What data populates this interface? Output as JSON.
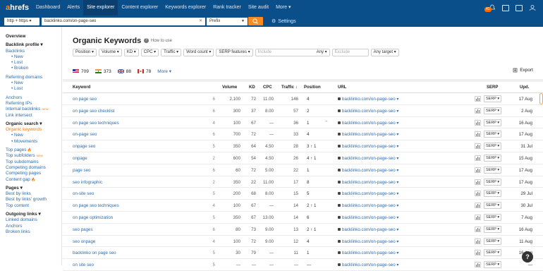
{
  "app": {
    "logo_a": "a",
    "logo_rest": "hrefs"
  },
  "nav": [
    "Dashboard",
    "Alerts",
    "Site explorer",
    "Content explorer",
    "Keywords explorer",
    "Rank tracker",
    "Site audit",
    "More ▾"
  ],
  "nav_active": "Site explorer",
  "top": {
    "notif_count": "41"
  },
  "search": {
    "protocol": "http + https ▾",
    "url": "backlinko.com/on-page-seo",
    "mode": "Prefix",
    "settings": "Settings"
  },
  "sidebar": [
    {
      "t": "Overview",
      "type": "h"
    },
    {
      "t": "Backlink profile ▾",
      "type": "h"
    },
    {
      "t": "Backlinks",
      "type": "link"
    },
    {
      "t": "• New",
      "type": "sub"
    },
    {
      "t": "• Lost",
      "type": "sub"
    },
    {
      "t": "• Broken",
      "type": "sub"
    },
    {
      "t": "Referring domains",
      "type": "link",
      "gap": true
    },
    {
      "t": "• New",
      "type": "sub"
    },
    {
      "t": "• Lost",
      "type": "sub"
    },
    {
      "t": "Anchors",
      "type": "link",
      "gap": true
    },
    {
      "t": "Referring IPs",
      "type": "link"
    },
    {
      "t": "Internal backlinks",
      "type": "link",
      "new": "NEW"
    },
    {
      "t": "Link intersect",
      "type": "link"
    },
    {
      "t": "Organic search ▾",
      "type": "h"
    },
    {
      "t": "Organic keywords",
      "type": "active"
    },
    {
      "t": "• New",
      "type": "sub"
    },
    {
      "t": "• Movements",
      "type": "sub"
    },
    {
      "t": "Top pages",
      "type": "link",
      "fire": true,
      "gap": true
    },
    {
      "t": "Top subfolders",
      "type": "link",
      "new": "NEW"
    },
    {
      "t": "Top subdomains",
      "type": "link"
    },
    {
      "t": "Competing domains",
      "type": "link"
    },
    {
      "t": "Competing pages",
      "type": "link"
    },
    {
      "t": "Content gap",
      "type": "link",
      "fire": true
    },
    {
      "t": "Pages ▾",
      "type": "h"
    },
    {
      "t": "Best by links",
      "type": "link"
    },
    {
      "t": "Best by links' growth",
      "type": "link"
    },
    {
      "t": "Top content",
      "type": "link"
    },
    {
      "t": "Outgoing links ▾",
      "type": "h"
    },
    {
      "t": "Linked domains",
      "type": "link"
    },
    {
      "t": "Anchors",
      "type": "link"
    },
    {
      "t": "Broken links",
      "type": "link"
    }
  ],
  "page": {
    "title": "Organic Keywords",
    "howto": "How to use"
  },
  "filters": [
    "Position ▾",
    "Volume ▾",
    "KD ▾",
    "CPC ▾",
    "Traffic ▾",
    "Word count ▾",
    "SERP features ▾"
  ],
  "filter_inputs": {
    "include": "Include",
    "any1": "Any ▾",
    "exclude": "Exclude",
    "any_target": "Any target ▾"
  },
  "countries": [
    {
      "code": "us",
      "count": "709"
    },
    {
      "code": "in",
      "count": "373"
    },
    {
      "code": "gb",
      "count": "88"
    },
    {
      "code": "ca",
      "count": "78"
    }
  ],
  "countries_more": "More ▾",
  "export": "Export",
  "columns": {
    "keyword": "Keyword",
    "volume": "Volume",
    "kd": "KD",
    "cpc": "CPC",
    "traffic": "Traffic ↓",
    "position": "Position",
    "url": "URL",
    "serp": "SERP",
    "upd": "Upd."
  },
  "rows": [
    {
      "kw": "on page seo",
      "p": "6",
      "vol": "2,100",
      "kd": "72",
      "cpc": "11.00",
      "traf": "146",
      "pos": "4",
      "url": "backlinko.com/on-page-seo ▾",
      "upd": "17 Aug"
    },
    {
      "kw": "on page seo checklist",
      "p": "6",
      "vol": "300",
      "kd": "37",
      "cpc": "8.00",
      "traf": "57",
      "pos": "2",
      "url": "backlinko.com/on-page-seo ▾",
      "upd": "2 Aug"
    },
    {
      "kw": "on page seo techniques",
      "p": "4",
      "vol": "100",
      "kd": "67",
      "cpc": "—",
      "traf": "36",
      "pos": "1",
      "feat": "“”",
      "url": "backlinko.com/on-page-seo ▾",
      "upd": "16 Aug"
    },
    {
      "kw": "on-page seo",
      "p": "6",
      "vol": "700",
      "kd": "72",
      "cpc": "—",
      "traf": "33",
      "pos": "4",
      "url": "backlinko.com/on-page-seo ▾",
      "upd": "17 Aug"
    },
    {
      "kw": "onpage seo",
      "p": "5",
      "vol": "350",
      "kd": "64",
      "cpc": "4.50",
      "traf": "28",
      "pos": "3 ↑ 1",
      "url": "backlinko.com/on-page-seo ▾",
      "upd": "31 Jul"
    },
    {
      "kw": "onpage",
      "p": "2",
      "vol": "600",
      "kd": "54",
      "cpc": "4.50",
      "traf": "26",
      "pos": "4 ↑ 1",
      "url": "backlinko.com/on-page-seo ▾",
      "upd": "15 Aug"
    },
    {
      "kw": "page seo",
      "p": "6",
      "vol": "60",
      "kd": "72",
      "cpc": "5.00",
      "traf": "22",
      "pos": "1",
      "url": "backlinko.com/on-page-seo ▾",
      "upd": "17 Aug"
    },
    {
      "kw": "seo infographic",
      "p": "2",
      "vol": "350",
      "kd": "22",
      "cpc": "11.00",
      "traf": "17",
      "pos": "8",
      "url": "backlinko.com/on-page-seo ▾",
      "upd": "17 Aug"
    },
    {
      "kw": "on-site seo",
      "p": "5",
      "vol": "200",
      "kd": "68",
      "cpc": "8.00",
      "traf": "15",
      "pos": "5",
      "url": "backlinko.com/on-page-seo ▾",
      "upd": "29 Jul"
    },
    {
      "kw": "on page seo techniques",
      "p": "4",
      "vol": "100",
      "kd": "67",
      "cpc": "—",
      "traf": "14",
      "pos": "2 ↑ 1",
      "url": "backlinko.com/on-page-seo ▾",
      "upd": "30 Jul"
    },
    {
      "kw": "on page optimization",
      "p": "5",
      "vol": "350",
      "kd": "67",
      "cpc": "13.00",
      "traf": "14",
      "pos": "6",
      "url": "backlinko.com/on-page-seo ▾",
      "upd": "7 Aug"
    },
    {
      "kw": "seo pages",
      "p": "6",
      "vol": "80",
      "kd": "73",
      "cpc": "9.00",
      "traf": "13",
      "pos": "2 ↑ 1",
      "url": "backlinko.com/on-page-seo ▾",
      "upd": "16 Aug"
    },
    {
      "kw": "seo onpage",
      "p": "4",
      "vol": "100",
      "kd": "72",
      "cpc": "9.00",
      "traf": "12",
      "pos": "4",
      "url": "backlinko.com/on-page-seo ▾",
      "upd": "11 Aug"
    },
    {
      "kw": "backlinko on page seo",
      "p": "5",
      "vol": "30",
      "kd": "79",
      "cpc": "—",
      "traf": "11",
      "pos": "1",
      "url": "backlinko.com/on-page-seo ▾",
      "upd": "16 Aug"
    },
    {
      "kw": "on site seo",
      "p": "5",
      "vol": "—",
      "kd": "—",
      "cpc": "—",
      "traf": "—",
      "pos": "—",
      "url": "backlinko.com/on-page-seo ▾",
      "upd": "—"
    }
  ],
  "serp_label": "SERP ▾",
  "colors": {
    "topbar": "#0b4f8a",
    "accent": "#ff8a1f",
    "link": "#2b6cb0"
  }
}
